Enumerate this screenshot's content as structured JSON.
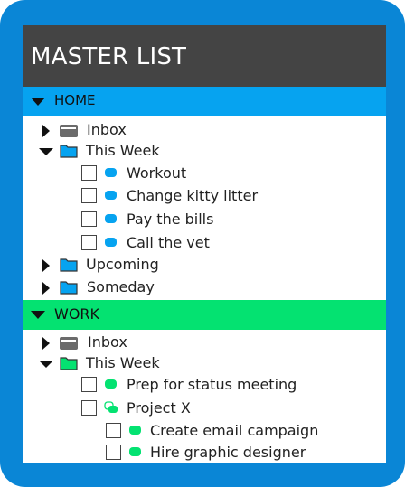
{
  "title": "MASTER LIST",
  "colors": {
    "frame": "#0a86d6",
    "title_bar": "#444444",
    "home_accent": "#06a3f0",
    "work_accent": "#04e271",
    "inbox_icon": "#6b6b6b"
  },
  "home": {
    "label": "HOME",
    "inbox": "Inbox",
    "this_week": "This Week",
    "tasks": [
      "Workout",
      "Change kitty litter",
      "Pay the bills",
      "Call the vet"
    ],
    "upcoming": "Upcoming",
    "someday": "Someday"
  },
  "work": {
    "label": "WORK",
    "inbox": "Inbox",
    "this_week": "This Week",
    "task": "Prep for status meeting",
    "project": "Project X",
    "subtasks": [
      "Create email campaign",
      "Hire graphic designer"
    ]
  },
  "icons": {
    "expanded": "triangle-down-icon",
    "collapsed": "triangle-right-icon",
    "inbox": "inbox-tray-icon",
    "folder": "folder-icon",
    "task": "task-dot-icon",
    "project": "project-icon"
  }
}
